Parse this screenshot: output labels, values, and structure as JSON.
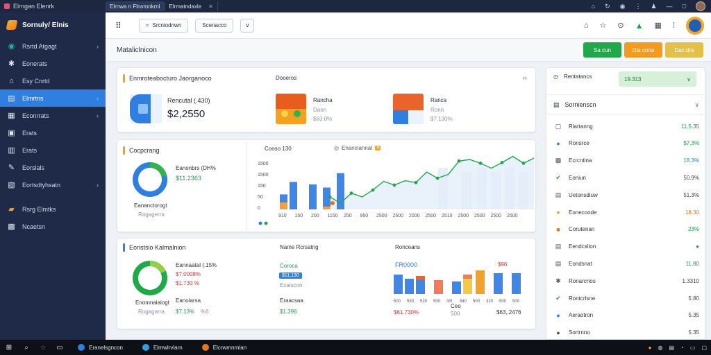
{
  "titlebar": {
    "app_name": "Elrngan Elenrk",
    "tabs": [
      {
        "label": "Elrnwa n Flrwmnkrnl"
      },
      {
        "label": "Elrmatndaxle"
      }
    ]
  },
  "sidebar": {
    "brand": "Sornuly/ Elnis",
    "items": [
      {
        "label": "Rsrtd Atgagt",
        "icon": "globe-icon",
        "chevron": "›"
      },
      {
        "label": "Eonerats",
        "icon": "gear-icon",
        "chevron": ""
      },
      {
        "label": "Esy Cnrtd",
        "icon": "home-icon",
        "chevron": ""
      },
      {
        "label": "Elmrtns",
        "icon": "list-icon",
        "chevron": "›",
        "active": true
      },
      {
        "label": "Econrrats",
        "icon": "calendar-icon",
        "chevron": "›"
      },
      {
        "label": "Erats",
        "icon": "folder-icon",
        "chevron": ""
      },
      {
        "label": "Erats",
        "icon": "briefcase-icon",
        "chevron": ""
      },
      {
        "label": "Eorslals",
        "icon": "pen-icon",
        "chevron": ""
      },
      {
        "label": "Eortsdtyhsatn",
        "icon": "chart-icon",
        "chevron": "›"
      },
      {
        "label": "Rsrg Elmtks",
        "icon": "tag-icon",
        "chevron": ""
      },
      {
        "label": "Ncaetsn",
        "icon": "grid-icon",
        "chevron": ""
      }
    ]
  },
  "toolbar": {
    "btn1": "Srcniodnwn",
    "btn2": "Scenacco",
    "btn3": "∨"
  },
  "page": {
    "title": "Mataliclnicon",
    "actions": [
      {
        "label": "Sa cun",
        "color": "#1fa94b"
      },
      {
        "label": "Dla cona",
        "color": "#f39a1f"
      },
      {
        "label": "Dac dra",
        "color": "#e4c04a"
      }
    ]
  },
  "summary": {
    "title": "Enmroteabocturo Jaorganoco",
    "subtitle": "Dooeros",
    "kpi1_label": "Rencutal (.430)",
    "kpi1_value": "$2,2550",
    "kpi2_label": "Rancha",
    "kpi2_sub": "Daon",
    "kpi2_value": "$63.0%",
    "kpi3_label": "Ranca",
    "kpi3_sub": "Ronn",
    "kpi3_value": "$7.130%"
  },
  "overview": {
    "title": "Cocpcrang",
    "donut_label": "Eanonbrs (DH%",
    "donut_value": "$11.2363",
    "donut_caption": "Eananctorogt",
    "donut_sub": "Ragagerra",
    "chart_title": "Cooso 130",
    "legend1": "Enanciannat",
    "legend_badge": "9"
  },
  "analysis": {
    "title": "Eonstsio Kalmalnion",
    "donut_label": "Eannaatal (.15%",
    "donut_value": "$7.0008%",
    "donut_sub": "$1,730 %",
    "donut_caption": "Enomnaiaiogt",
    "donut_sub2": "Rogagarra",
    "col2_head": "Name Rcrsatng",
    "col2_label": "Coroca",
    "col2_badge": "$11,130",
    "col2_sub": "Ecalscon",
    "col2_bottom_label": "Eraacsaa",
    "col2_bottom": "$1,396",
    "col3_head": "Ronceans",
    "col3_label": "FR0000",
    "col3_tag": "$96",
    "col3_bottom_label": "Ceo",
    "col3_bottom_sub": "500",
    "col3_bottom1": "$61.730%",
    "col3_bottom2": "$63,.2476",
    "left_bottom_label": "Eanoiarsa",
    "left_bottom": "$7.13%",
    "left_bottom_muted": "%6"
  },
  "right_panel": {
    "select_label": "Rentatancs",
    "select_value": "19.313",
    "section": "Sornienscn",
    "rows": [
      {
        "label": "Rlartanng",
        "value": "11.5.35",
        "icon": "box-icon",
        "color": "#1f9d47"
      },
      {
        "label": "Ronsrce",
        "value": "$7.3%",
        "icon": "dot-icon",
        "color": "#1f9d47"
      },
      {
        "label": "Ecrcntina",
        "value": "18.3%",
        "icon": "grid-icon",
        "color": "#2f7fe0"
      },
      {
        "label": "Eoniun",
        "value": "50.9%",
        "icon": "check-icon",
        "color": "#444444"
      },
      {
        "label": "Uetonsdiuw",
        "value": "51.3%",
        "icon": "doc-icon",
        "color": "#444444"
      },
      {
        "label": "Eonecoode",
        "value": "18.30",
        "icon": "circle-icon",
        "color": "#e8751a"
      },
      {
        "label": "Corutenan",
        "value": "23%",
        "icon": "square-icon",
        "color": "#1f9d47"
      },
      {
        "label": "Eendcslion",
        "value": "●",
        "icon": "doc-icon",
        "color": "#1f9d47"
      },
      {
        "label": "Eondsnat",
        "value": "11.80",
        "icon": "doc-icon",
        "color": "#1f9d47"
      },
      {
        "label": "Ronarcnos",
        "value": "1.3310",
        "icon": "gear-icon",
        "color": "#444444"
      },
      {
        "label": "Rontcrlsne",
        "value": "5.80",
        "icon": "check-icon",
        "color": "#444444"
      },
      {
        "label": "Aeraotron",
        "value": "5.35",
        "icon": "circle-icon",
        "color": "#444444"
      },
      {
        "label": "Sortrnno",
        "value": "5.35",
        "icon": "circle-icon",
        "color": "#444444"
      }
    ]
  },
  "taskbar": {
    "apps": [
      {
        "label": "Eranelsgncon",
        "color": "#2f7fe0"
      },
      {
        "label": "Elrnwlrvlarn",
        "color": "#2f9fe0"
      },
      {
        "label": "Elcrwmnrnlan",
        "color": "#e8751a"
      }
    ]
  },
  "colors": {
    "accent": "#2f7fe0",
    "sidebar_bg": "#1e2a47",
    "green": "#1f9d47",
    "orange": "#f39a1f"
  },
  "chart_data": [
    {
      "type": "bar",
      "title": "",
      "series": [
        {
          "name": "",
          "values": [
            44,
            40,
            35,
            58,
            42,
            42
          ]
        },
        {
          "name": "",
          "values": [
            10,
            4,
            0,
            20,
            0,
            0
          ]
        }
      ],
      "line": [
        40,
        20,
        52,
        40,
        62,
        90,
        78,
        92,
        86,
        120,
        100,
        112,
        155,
        160,
        148,
        132,
        150,
        170,
        148,
        165
      ],
      "ytick_labels": [
        "1500",
        "1500",
        "150",
        "50",
        "0"
      ],
      "xtick_labels": [
        "910",
        "150",
        "200",
        "1150",
        "250",
        "950",
        "2500",
        "2500",
        "2000",
        "2500",
        "2510",
        "2500",
        "2500",
        "2500",
        "2500"
      ]
    },
    {
      "type": "bar",
      "series": [
        {
          "name": "",
          "values": [
            40,
            30,
            33,
            30,
            25,
            26,
            28,
            45,
            40,
            48,
            32,
            42,
            34
          ]
        }
      ],
      "xtick_labels": [
        "500",
        "530",
        "520",
        "500",
        "3/0",
        "540",
        "500",
        "320",
        "500",
        "500"
      ]
    }
  ]
}
